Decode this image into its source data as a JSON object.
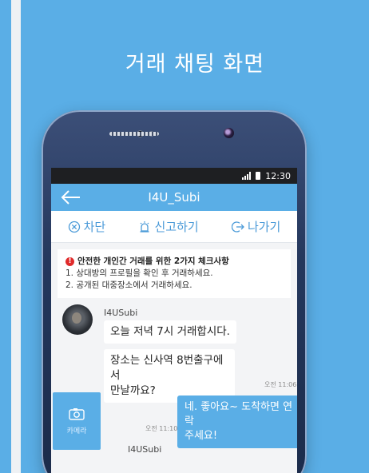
{
  "headline": "거래 채팅 화면",
  "status_bar": {
    "time": "12:30"
  },
  "chat_header": {
    "title": "I4U_Subi"
  },
  "actions": {
    "block_label": "차단",
    "report_label": "신고하기",
    "leave_label": "나가기"
  },
  "notice": {
    "title": "안전한 개인간 거래를 위한 2가지 체크사항",
    "line1": "1. 상대방의 프로필을 확인 후 거래하세요.",
    "line2": "2. 공개된 대중장소에서 거래하세요."
  },
  "messages": [
    {
      "sender": "I4USubi",
      "text": "오늘 저녁 7시 거래합시다."
    },
    {
      "text_line1": "장소는 신사역 8번출구에서",
      "text_line2": "만날까요?",
      "time": "오전 11:06"
    },
    {
      "text_line1": "네. 좋아요~ 도착하면 연락",
      "text_line2": "주세요!",
      "time": "오전 11:10"
    },
    {
      "sender": "I4USubi"
    }
  ],
  "camera_button": {
    "label": "카메라"
  },
  "colors": {
    "accent": "#5aaee6",
    "warning": "#e02b2b"
  }
}
